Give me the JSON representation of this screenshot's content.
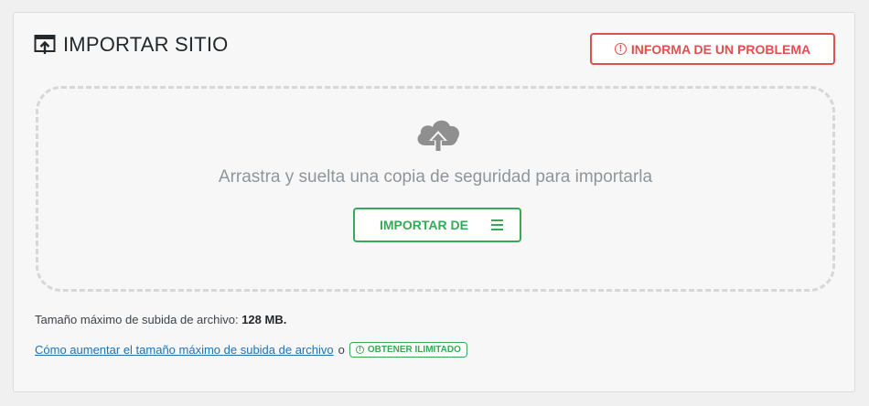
{
  "header": {
    "title": "IMPORTAR SITIO",
    "title_icon": "import-site-icon",
    "report_button": "INFORMA DE UN PROBLEMA",
    "report_icon": "warning-circle-icon"
  },
  "dropzone": {
    "icon": "cloud-upload-icon",
    "text": "Arrastra y suelta una copia de seguridad para importarla",
    "import_button": "IMPORTAR DE",
    "import_menu_icon": "hamburger-menu-icon"
  },
  "footer": {
    "max_size_label": "Tamaño máximo de subida de archivo:",
    "max_size_value": "128 MB.",
    "help_link": "Cómo aumentar el tamaño máximo de subida de archivo",
    "separator": "o",
    "unlimited_button": "OBTENER ILIMITADO"
  },
  "colors": {
    "accent_green": "#36a856",
    "danger_red": "#e04e4e",
    "link_blue": "#2271b1"
  }
}
